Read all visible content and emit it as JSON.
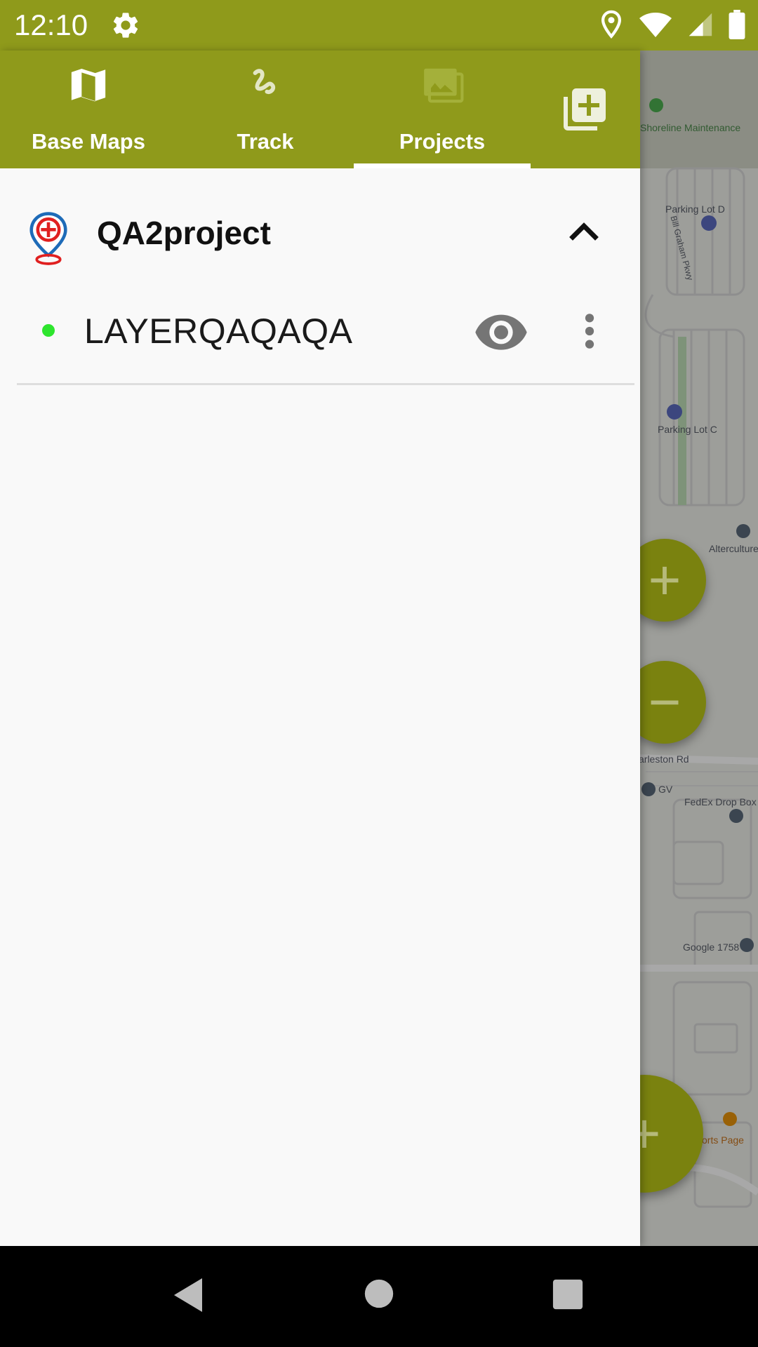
{
  "status_bar": {
    "time": "12:10",
    "icons": [
      "settings-gear-icon",
      "location-pin-icon",
      "wifi-icon",
      "cell-signal-icon",
      "battery-icon"
    ],
    "background_color": "#8f9a1b"
  },
  "tabs": [
    {
      "label": "Base Maps",
      "icon": "map-icon",
      "selected": false
    },
    {
      "label": "Track",
      "icon": "track-squiggle-icon",
      "selected": false
    },
    {
      "label": "Projects",
      "icon": "image-icon",
      "selected": true
    }
  ],
  "header_actions": {
    "add_icon": "add-to-library-icon"
  },
  "project": {
    "name": "QA2project",
    "logo_icon": "project-pin-logo-icon",
    "expanded": true,
    "collapse_icon": "chevron-up-icon"
  },
  "layers": [
    {
      "name": "LAYERQAQAQA",
      "status_color": "#2ee52e",
      "visibility_icon": "eye-icon",
      "menu_icon": "more-vert-icon"
    }
  ],
  "map": {
    "labels": {
      "shoreline": "Shoreline Maintenance",
      "parking_d": "Parking Lot D",
      "parking_c": "Parking Lot C",
      "bill_graham": "Bill Graham Pkwy",
      "alterculture": "Alterculture",
      "charleston": "arleston Rd",
      "gv": "GV",
      "fedex": "FedEx Drop Box",
      "google": "Google 1758",
      "sports": "orts Page"
    },
    "fabs": [
      "zoom-in-button",
      "zoom-out-button",
      "add-feature-button"
    ]
  },
  "nav_bar": {
    "buttons": [
      "back-button",
      "home-button",
      "recents-button"
    ]
  }
}
